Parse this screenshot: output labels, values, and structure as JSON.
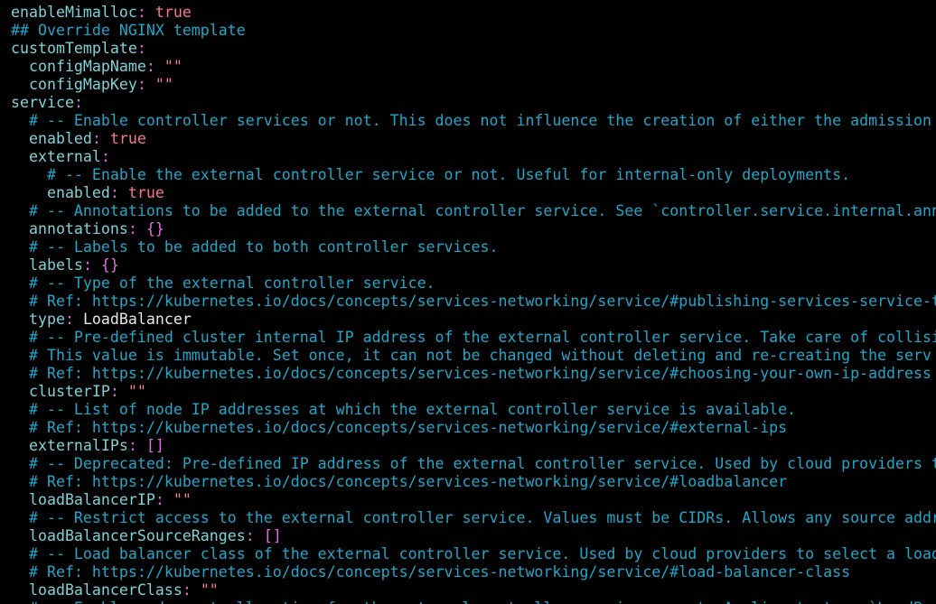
{
  "editor": {
    "colors": {
      "background": "#000000",
      "key": "#7DD3D8",
      "punctuation": "#E06CE6",
      "value": "#F7768E",
      "plain": "#E8E8E8",
      "comment": "#1FA7C9"
    },
    "lines": [
      [
        {
          "t": "key",
          "v": "enableMimalloc"
        },
        {
          "t": "colon",
          "v": ": "
        },
        {
          "t": "bool",
          "v": "true"
        }
      ],
      [
        {
          "t": "heading",
          "v": "## Override NGINX template"
        }
      ],
      [
        {
          "t": "key",
          "v": "customTemplate"
        },
        {
          "t": "colon",
          "v": ":"
        }
      ],
      [
        {
          "t": "key",
          "v": "  configMapName"
        },
        {
          "t": "colon",
          "v": ": "
        },
        {
          "t": "str",
          "v": "\"\""
        }
      ],
      [
        {
          "t": "key",
          "v": "  configMapKey"
        },
        {
          "t": "colon",
          "v": ": "
        },
        {
          "t": "str",
          "v": "\"\""
        }
      ],
      [
        {
          "t": "key",
          "v": "service"
        },
        {
          "t": "colon",
          "v": ":"
        }
      ],
      [
        {
          "t": "comment",
          "v": "  # -- Enable controller services or not. This does not influence the creation of either the admission"
        }
      ],
      [
        {
          "t": "key",
          "v": "  enabled"
        },
        {
          "t": "colon",
          "v": ": "
        },
        {
          "t": "bool",
          "v": "true"
        }
      ],
      [
        {
          "t": "key",
          "v": "  external"
        },
        {
          "t": "colon",
          "v": ":"
        }
      ],
      [
        {
          "t": "comment",
          "v": "    # -- Enable the external controller service or not. Useful for internal-only deployments."
        }
      ],
      [
        {
          "t": "key",
          "v": "    enabled"
        },
        {
          "t": "colon",
          "v": ": "
        },
        {
          "t": "bool",
          "v": "true"
        }
      ],
      [
        {
          "t": "comment",
          "v": "  # -- Annotations to be added to the external controller service. See `controller.service.internal.ann"
        }
      ],
      [
        {
          "t": "key",
          "v": "  annotations"
        },
        {
          "t": "colon",
          "v": ": {}"
        }
      ],
      [
        {
          "t": "comment",
          "v": "  # -- Labels to be added to both controller services."
        }
      ],
      [
        {
          "t": "key",
          "v": "  labels"
        },
        {
          "t": "colon",
          "v": ": {}"
        }
      ],
      [
        {
          "t": "comment",
          "v": "  # -- Type of the external controller service."
        }
      ],
      [
        {
          "t": "comment",
          "v": "  # Ref: https://kubernetes.io/docs/concepts/services-networking/service/#publishing-services-service-t"
        }
      ],
      [
        {
          "t": "key",
          "v": "  type"
        },
        {
          "t": "colon",
          "v": ": "
        },
        {
          "t": "plain",
          "v": "LoadBalancer"
        }
      ],
      [
        {
          "t": "comment",
          "v": "  # -- Pre-defined cluster internal IP address of the external controller service. Take care of collisi"
        }
      ],
      [
        {
          "t": "comment",
          "v": "  # This value is immutable. Set once, it can not be changed without deleting and re-creating the serv"
        }
      ],
      [
        {
          "t": "comment",
          "v": "  # Ref: https://kubernetes.io/docs/concepts/services-networking/service/#choosing-your-own-ip-address"
        }
      ],
      [
        {
          "t": "key",
          "v": "  clusterIP"
        },
        {
          "t": "colon",
          "v": ": "
        },
        {
          "t": "str",
          "v": "\"\""
        }
      ],
      [
        {
          "t": "comment",
          "v": "  # -- List of node IP addresses at which the external controller service is available."
        }
      ],
      [
        {
          "t": "comment",
          "v": "  # Ref: https://kubernetes.io/docs/concepts/services-networking/service/#external-ips"
        }
      ],
      [
        {
          "t": "key",
          "v": "  externalIPs"
        },
        {
          "t": "colon",
          "v": ": []"
        }
      ],
      [
        {
          "t": "comment",
          "v": "  # -- Deprecated: Pre-defined IP address of the external controller service. Used by cloud providers t"
        }
      ],
      [
        {
          "t": "comment",
          "v": "  # Ref: https://kubernetes.io/docs/concepts/services-networking/service/#loadbalancer"
        }
      ],
      [
        {
          "t": "key",
          "v": "  loadBalancerIP"
        },
        {
          "t": "colon",
          "v": ": "
        },
        {
          "t": "str",
          "v": "\"\""
        }
      ],
      [
        {
          "t": "comment",
          "v": "  # -- Restrict access to the external controller service. Values must be CIDRs. Allows any source addr"
        }
      ],
      [
        {
          "t": "key",
          "v": "  loadBalancerSourceRanges"
        },
        {
          "t": "colon",
          "v": ": []"
        }
      ],
      [
        {
          "t": "comment",
          "v": "  # -- Load balancer class of the external controller service. Used by cloud providers to select a load"
        }
      ],
      [
        {
          "t": "comment",
          "v": "  # Ref: https://kubernetes.io/docs/concepts/services-networking/service/#load-balancer-class"
        }
      ],
      [
        {
          "t": "key",
          "v": "  loadBalancerClass"
        },
        {
          "t": "colon",
          "v": ": "
        },
        {
          "t": "str",
          "v": "\"\""
        }
      ],
      [
        {
          "t": "comment",
          "v": "  # -- Enable node port allocation for the external controller service or not. Applies to type `LoadBa"
        }
      ]
    ]
  }
}
